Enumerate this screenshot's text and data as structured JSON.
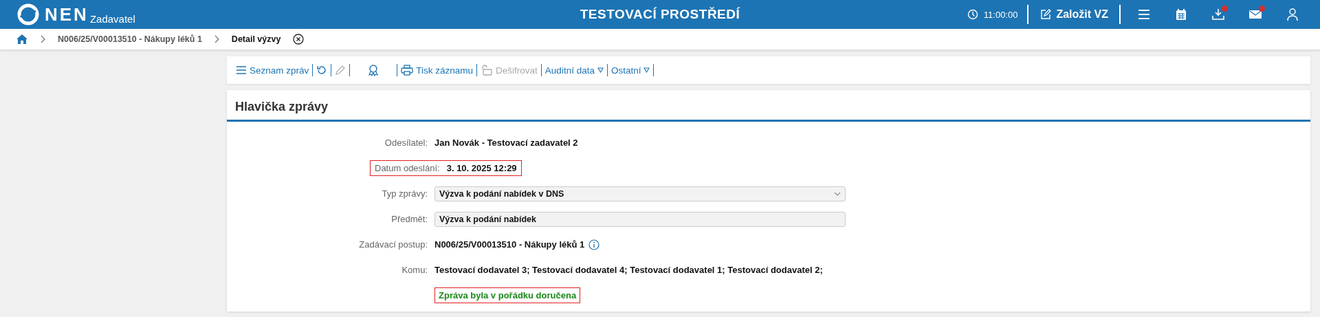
{
  "topbar": {
    "logo": "NEN",
    "subtitle": "Zadavatel",
    "title": "TESTOVACÍ PROSTŘEDÍ",
    "time": "11:00:00",
    "create": "Založit VZ",
    "icons": [
      {
        "kind": "menu",
        "badge": false
      },
      {
        "kind": "calendar",
        "badge": false
      },
      {
        "kind": "download",
        "badge": true
      },
      {
        "kind": "mail",
        "badge": true
      },
      {
        "kind": "user",
        "badge": false
      }
    ]
  },
  "breadcrumb": {
    "items": [
      {
        "label": "N006/25/V00013510 - Nákupy léků 1",
        "current": false
      },
      {
        "label": "Detail výzvy",
        "current": true
      }
    ]
  },
  "toolbar": [
    {
      "kind": "list",
      "label": "Seznam zpráv",
      "disabled": false
    },
    {
      "kind": "refresh",
      "disabled": false
    },
    {
      "kind": "pencil",
      "disabled": true
    },
    {
      "kind": "award",
      "disabled": false
    },
    {
      "kind": "print",
      "label": "Tisk záznamu",
      "disabled": false
    },
    {
      "kind": "lock",
      "label": "Dešifrovat",
      "disabled": true
    },
    {
      "kind": "dropdown",
      "label": "Auditní data",
      "disabled": false
    },
    {
      "kind": "dropdown",
      "label": "Ostatní",
      "disabled": false
    }
  ],
  "card": {
    "title": "Hlavička zprávy",
    "fields": [
      {
        "kind": "text",
        "label": "Odesílatel:",
        "value": "Jan Novák - Testovací zadavatel 2",
        "highlighted": false
      },
      {
        "kind": "text",
        "label": "Datum odeslání:",
        "value": "3. 10. 2025 12:29",
        "highlighted": true
      },
      {
        "kind": "select",
        "label": "Typ zprávy:",
        "value": "Výzva k podání nabídek v DNS",
        "highlighted": false
      },
      {
        "kind": "input",
        "label": "Předmět:",
        "value": "Výzva k podání nabídek",
        "highlighted": false
      },
      {
        "kind": "info",
        "label": "Zadávací postup:",
        "value": "N006/25/V00013510 - Nákupy léků 1",
        "highlighted": false
      },
      {
        "kind": "text",
        "label": "Komu:",
        "value": "Testovací dodavatel 3; Testovací dodavatel 4; Testovací dodavatel 1; Testovací dodavatel 2;",
        "highlighted": false
      },
      {
        "kind": "status",
        "value": "Zpráva byla v pořádku doručena",
        "highlighted": true
      }
    ]
  }
}
